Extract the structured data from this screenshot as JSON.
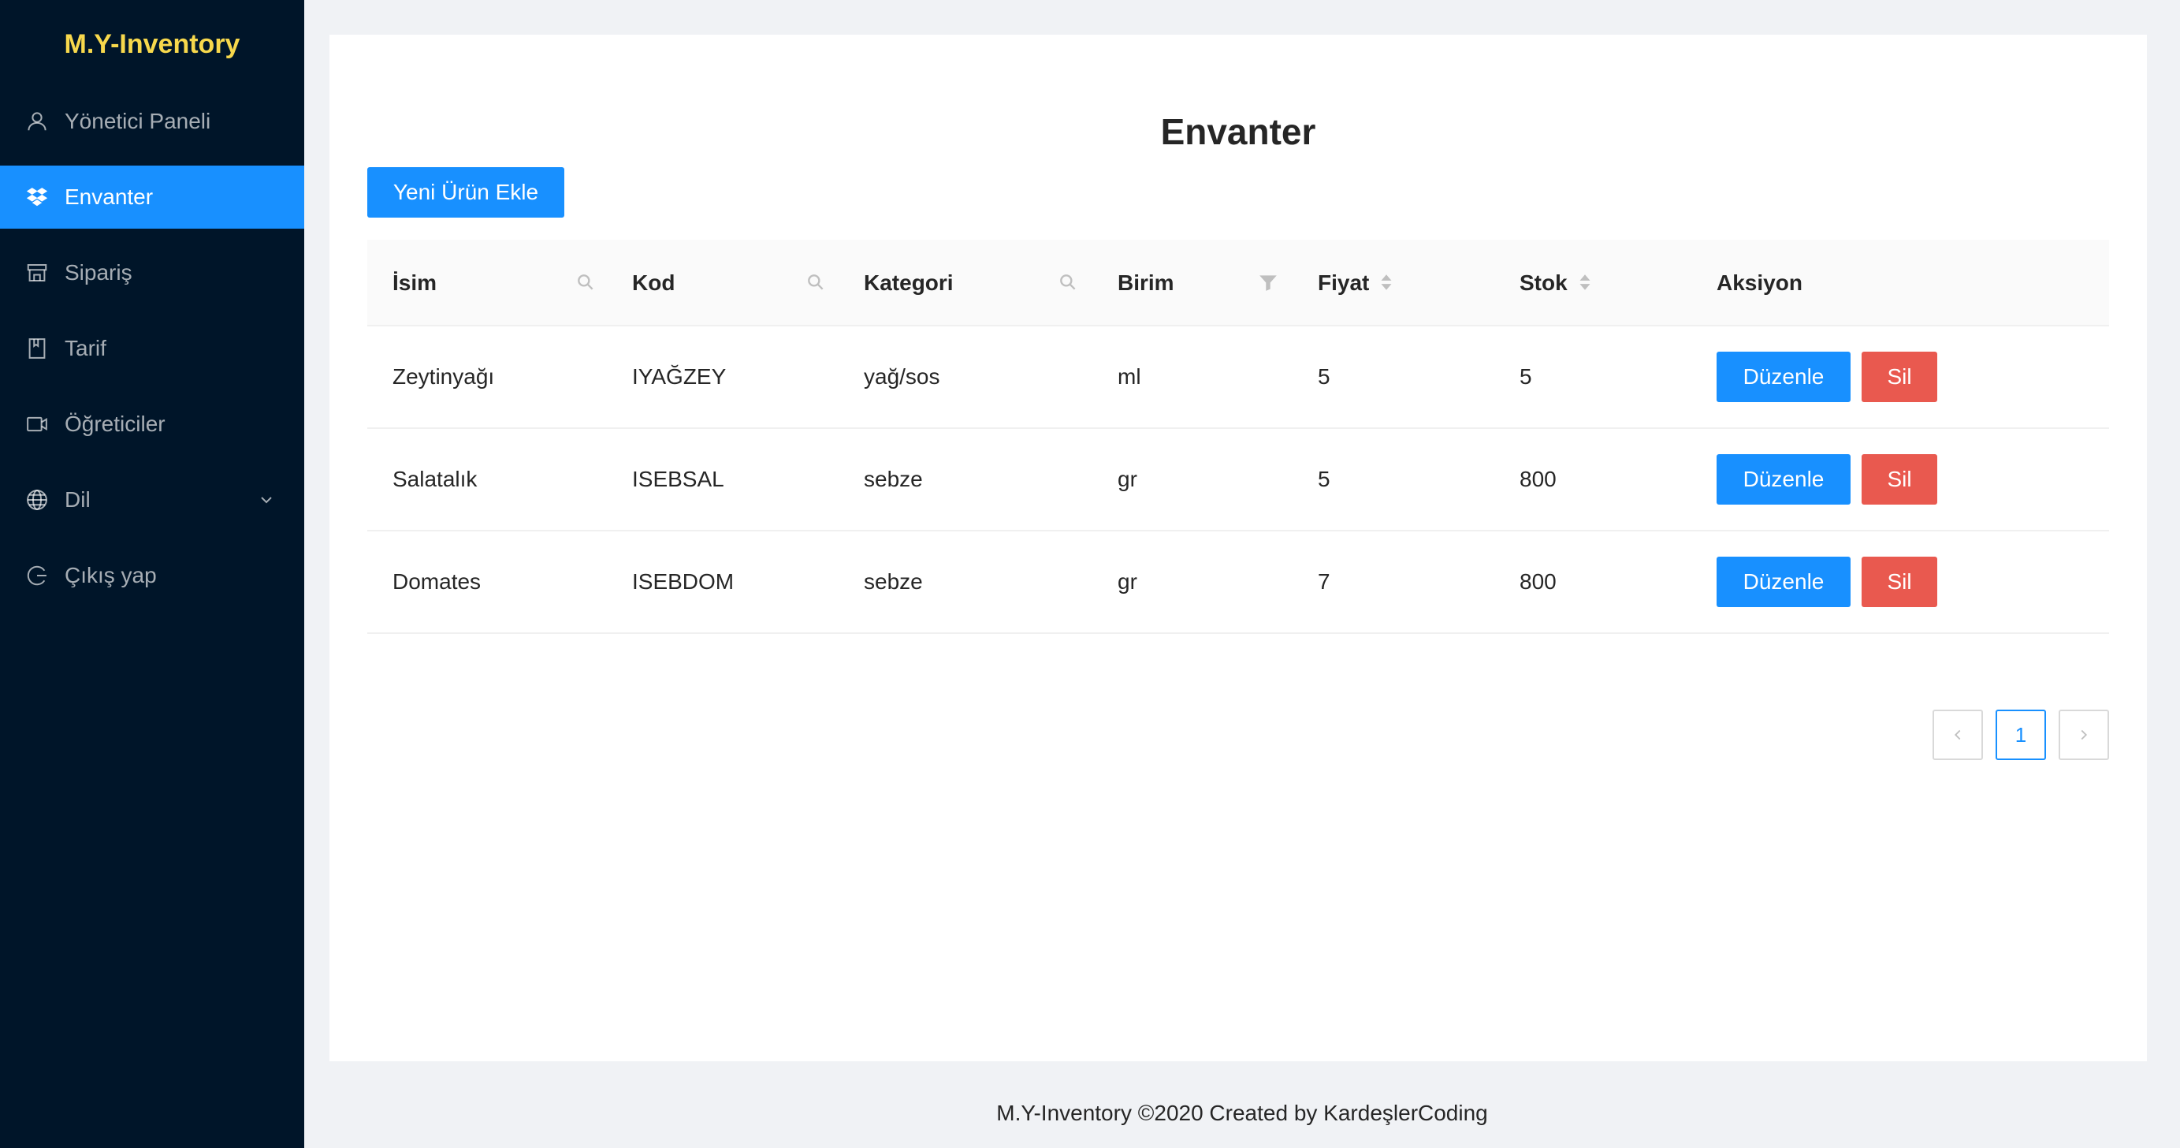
{
  "app": {
    "logo": "M.Y-Inventory"
  },
  "sidebar": {
    "items": [
      {
        "label": "Yönetici Paneli",
        "icon": "user-icon",
        "active": false
      },
      {
        "label": "Envanter",
        "icon": "dropbox-icon",
        "active": true
      },
      {
        "label": "Sipariş",
        "icon": "shop-icon",
        "active": false
      },
      {
        "label": "Tarif",
        "icon": "book-icon",
        "active": false
      },
      {
        "label": "Öğreticiler",
        "icon": "video-camera-icon",
        "active": false
      },
      {
        "label": "Dil",
        "icon": "globe-icon",
        "active": false,
        "expandable": true
      },
      {
        "label": "Çıkış yap",
        "icon": "logout-icon",
        "active": false
      }
    ]
  },
  "main": {
    "title": "Envanter",
    "add_button": "Yeni Ürün Ekle",
    "table": {
      "columns": [
        {
          "label": "İsim",
          "icon": "search-icon"
        },
        {
          "label": "Kod",
          "icon": "search-icon"
        },
        {
          "label": "Kategori",
          "icon": "search-icon"
        },
        {
          "label": "Birim",
          "icon": "filter-icon"
        },
        {
          "label": "Fiyat",
          "icon": "sort-icon"
        },
        {
          "label": "Stok",
          "icon": "sort-icon"
        },
        {
          "label": "Aksiyon",
          "icon": ""
        }
      ],
      "rows": [
        {
          "name": "Zeytinyağı",
          "code": "IYAĞZEY",
          "category": "yağ/sos",
          "unit": "ml",
          "price": "5",
          "stock": "5"
        },
        {
          "name": "Salatalık",
          "code": "ISEBSAL",
          "category": "sebze",
          "unit": "gr",
          "price": "5",
          "stock": "800"
        },
        {
          "name": "Domates",
          "code": "ISEBDOM",
          "category": "sebze",
          "unit": "gr",
          "price": "7",
          "stock": "800"
        }
      ],
      "edit_label": "Düzenle",
      "delete_label": "Sil"
    },
    "pagination": {
      "current_page": "1"
    }
  },
  "footer": {
    "text": "M.Y-Inventory ©2020 Created by KardeşlerCoding"
  },
  "colors": {
    "sidebar_bg": "#001529",
    "logo": "#f7d84c",
    "primary": "#1890ff",
    "danger": "#e9594f",
    "page_bg": "#f0f2f5"
  }
}
